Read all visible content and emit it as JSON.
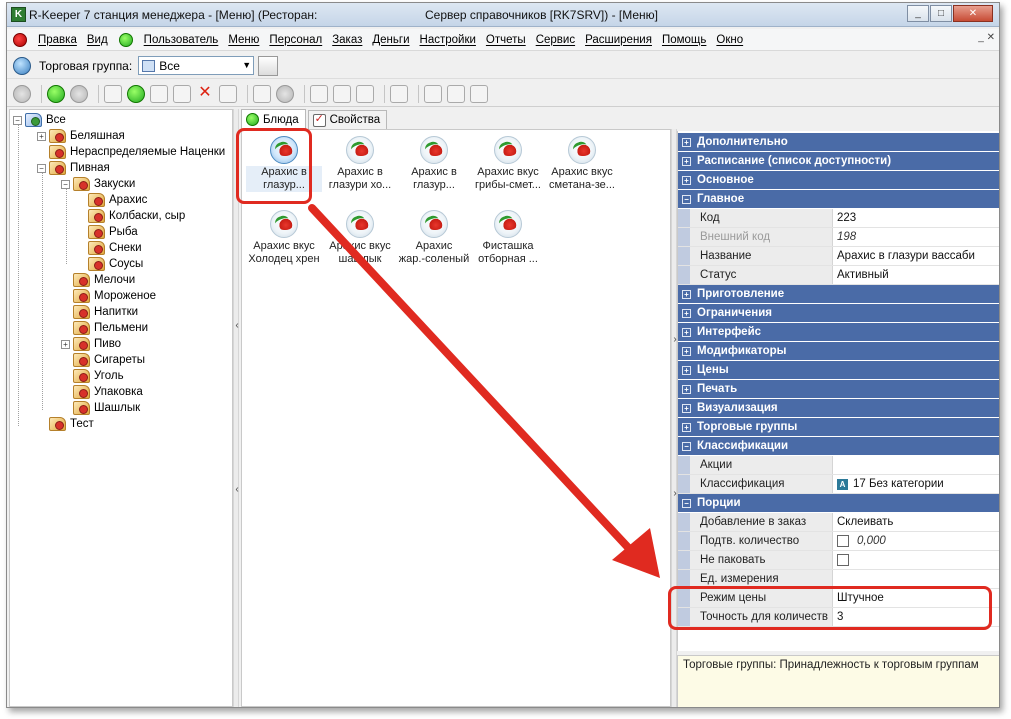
{
  "window": {
    "title_left": "R-Keeper 7 станция менеджера - [Меню] (Ресторан:",
    "title_right": "Сервер справочников [RK7SRV]) - [Меню]"
  },
  "menu": {
    "items": [
      "Правка",
      "Вид",
      "Пользователь",
      "Меню",
      "Персонал",
      "Заказ",
      "Деньги",
      "Настройки",
      "Отчеты",
      "Сервис",
      "Расширения",
      "Помощь",
      "Окно"
    ]
  },
  "trade_group": {
    "label": "Торговая группа:",
    "value": "Все"
  },
  "tree": {
    "items": [
      {
        "label": "Все"
      },
      {
        "label": "Беляшная"
      },
      {
        "label": "Нераспределяемые Наценки"
      },
      {
        "label": "Пивная"
      },
      {
        "label": "Закуски"
      },
      {
        "label": "Арахис"
      },
      {
        "label": "Колбаски, сыр"
      },
      {
        "label": "Рыба"
      },
      {
        "label": "Снеки"
      },
      {
        "label": "Соусы"
      },
      {
        "label": "Мелочи"
      },
      {
        "label": "Мороженое"
      },
      {
        "label": "Напитки"
      },
      {
        "label": "Пельмени"
      },
      {
        "label": "Пиво"
      },
      {
        "label": "Сигареты"
      },
      {
        "label": "Уголь"
      },
      {
        "label": "Упаковка"
      },
      {
        "label": "Шашлык"
      },
      {
        "label": "Тест"
      }
    ]
  },
  "tabs": {
    "dishes": "Блюда",
    "properties": "Свойства"
  },
  "dishes": [
    {
      "line1": "Арахис в",
      "line2": "глазур..."
    },
    {
      "line1": "Арахис в",
      "line2": "глазури хо..."
    },
    {
      "line1": "Арахис в",
      "line2": "глазур..."
    },
    {
      "line1": "Арахис вкус",
      "line2": "грибы-смет..."
    },
    {
      "line1": "Арахис вкус",
      "line2": "сметана-зе..."
    },
    {
      "line1": "Арахис вкус",
      "line2": "Холодец хрен"
    },
    {
      "line1": "Арахис вкус",
      "line2": "шашлык"
    },
    {
      "line1": "Арахис",
      "line2": "жар.-соленый"
    },
    {
      "line1": "Фисташка",
      "line2": "отборная ..."
    }
  ],
  "properties": {
    "sections": {
      "additional": "Дополнительно",
      "schedule": "Расписание (список доступности)",
      "basic": "Основное",
      "main": "Главное",
      "preparation": "Приготовление",
      "restrictions": "Ограничения",
      "interface": "Интерфейс",
      "modifiers": "Модификаторы",
      "prices": "Цены",
      "print": "Печать",
      "visualization": "Визуализация",
      "trade_groups": "Торговые группы",
      "classifications": "Классификации",
      "portions": "Порции"
    },
    "main_rows": {
      "code_key": "Код",
      "code_val": "223",
      "ext_code_key": "Внешний код",
      "ext_code_val": "198",
      "name_key": "Название",
      "name_val": "Арахис в глазури вассаби",
      "status_key": "Статус",
      "status_val": "Активный"
    },
    "class_rows": {
      "actions_key": "Акции",
      "class_key": "Классификация",
      "class_badge": "А",
      "class_val": "17 Без категории"
    },
    "portion_rows": {
      "add_key": "Добавление в заказ",
      "add_val": "Склеивать",
      "confirm_key": "Подтв. количество",
      "confirm_val": "0,000",
      "nopack_key": "Не паковать",
      "unit_key": "Ед. измерения",
      "pricemode_key": "Режим цены",
      "pricemode_val": "Штучное",
      "precision_key": "Точность для количеств",
      "precision_val": "3"
    }
  },
  "hint": {
    "text": "Торговые группы: Принадлежность к торговым группам"
  },
  "colors": {
    "section_bg": "#4a6ba7",
    "annotation_red": "#e02a20"
  }
}
